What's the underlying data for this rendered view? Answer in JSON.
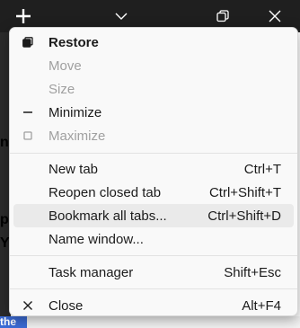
{
  "window_controls": {
    "new_tab_icon": "plus-icon",
    "tab_list_icon": "chevron-down-icon",
    "restore_icon": "restore-icon",
    "close_icon": "close-icon"
  },
  "page_fragments": [
    "nc",
    "p",
    "Yo",
    "the"
  ],
  "menu": {
    "items": [
      {
        "label": "Restore",
        "shortcut": "",
        "icon": "restore-icon",
        "state": "enabled",
        "bold": true
      },
      {
        "label": "Move",
        "shortcut": "",
        "icon": "",
        "state": "disabled"
      },
      {
        "label": "Size",
        "shortcut": "",
        "icon": "",
        "state": "disabled"
      },
      {
        "label": "Minimize",
        "shortcut": "",
        "icon": "minimize-icon",
        "state": "enabled"
      },
      {
        "label": "Maximize",
        "shortcut": "",
        "icon": "maximize-icon",
        "state": "disabled"
      },
      {
        "label": "New tab",
        "shortcut": "Ctrl+T",
        "icon": "",
        "state": "enabled"
      },
      {
        "label": "Reopen closed tab",
        "shortcut": "Ctrl+Shift+T",
        "icon": "",
        "state": "enabled"
      },
      {
        "label": "Bookmark all tabs...",
        "shortcut": "Ctrl+Shift+D",
        "icon": "",
        "state": "hover"
      },
      {
        "label": "Name window...",
        "shortcut": "",
        "icon": "",
        "state": "enabled"
      },
      {
        "label": "Task manager",
        "shortcut": "Shift+Esc",
        "icon": "",
        "state": "enabled"
      },
      {
        "label": "Close",
        "shortcut": "Alt+F4",
        "icon": "close-icon",
        "state": "enabled"
      }
    ]
  },
  "colors": {
    "titlebar": "#1f1f1f",
    "menu_bg": "#f9f9f9",
    "hover_bg": "#eaeaea",
    "disabled_text": "#a0a0a0",
    "text": "#1b1b1b"
  }
}
